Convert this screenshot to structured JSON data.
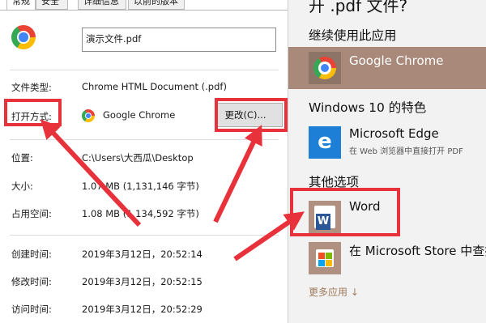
{
  "tabs": [
    "常规",
    "安全",
    "详细信息",
    "以前的版本"
  ],
  "file": {
    "name": "演示文件.pdf"
  },
  "properties": {
    "type_label": "文件类型:",
    "type_value": "Chrome HTML Document (.pdf)",
    "open_label": "打开方式:",
    "open_value": "Google Chrome",
    "change_button": "更改(C)...",
    "location_label": "位置:",
    "location_value": "C:\\Users\\大西瓜\\Desktop",
    "size_label": "大小:",
    "size_value": "1.07 MB (1,131,146 字节)",
    "disk_label": "占用空间:",
    "disk_value": "1.08 MB (1,134,592 字节)",
    "created_label": "创建时间:",
    "created_value": "2019年3月12日，20:52:14",
    "modified_label": "修改时间:",
    "modified_value": "2019年3月12日，20:52:15",
    "accessed_label": "访问时间:",
    "accessed_value": "2019年3月12日，20:52:29"
  },
  "chooser": {
    "title_partial": "开 .pdf 文件?",
    "continue_heading": "继续使用此应用",
    "current_app": "Google Chrome",
    "featured_heading": "Windows 10 的特色",
    "edge_title": "Microsoft Edge",
    "edge_sub": "在 Web 浏览器中直接打开 PDF",
    "other_heading": "其他选项",
    "word_title": "Word",
    "store_title": "在 Microsoft Store 中查找",
    "more_apps": "更多应用 ↓"
  },
  "colors": {
    "annotation_red": "#e8323b",
    "selected_bg": "#a8897a",
    "edge_blue": "#1e7fd6"
  }
}
